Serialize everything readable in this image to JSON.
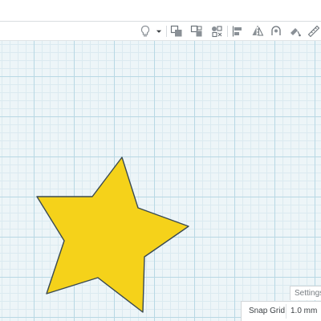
{
  "toolbar": {
    "icons": [
      "light-bulb-icon",
      "dropdown-arrow-icon",
      "group-icon",
      "ungroup-icon",
      "align-icon",
      "flip-icon",
      "mirror-icon",
      "fill-icon",
      "ruler-icon"
    ]
  },
  "canvas": {
    "star_color": "#f5d21a",
    "star_outline": "#3a4a52",
    "grid_color": "#b8d8e4"
  },
  "settings": {
    "label": "Settings"
  },
  "snap_grid": {
    "label": "Snap Grid",
    "value": "1.0 mm"
  }
}
